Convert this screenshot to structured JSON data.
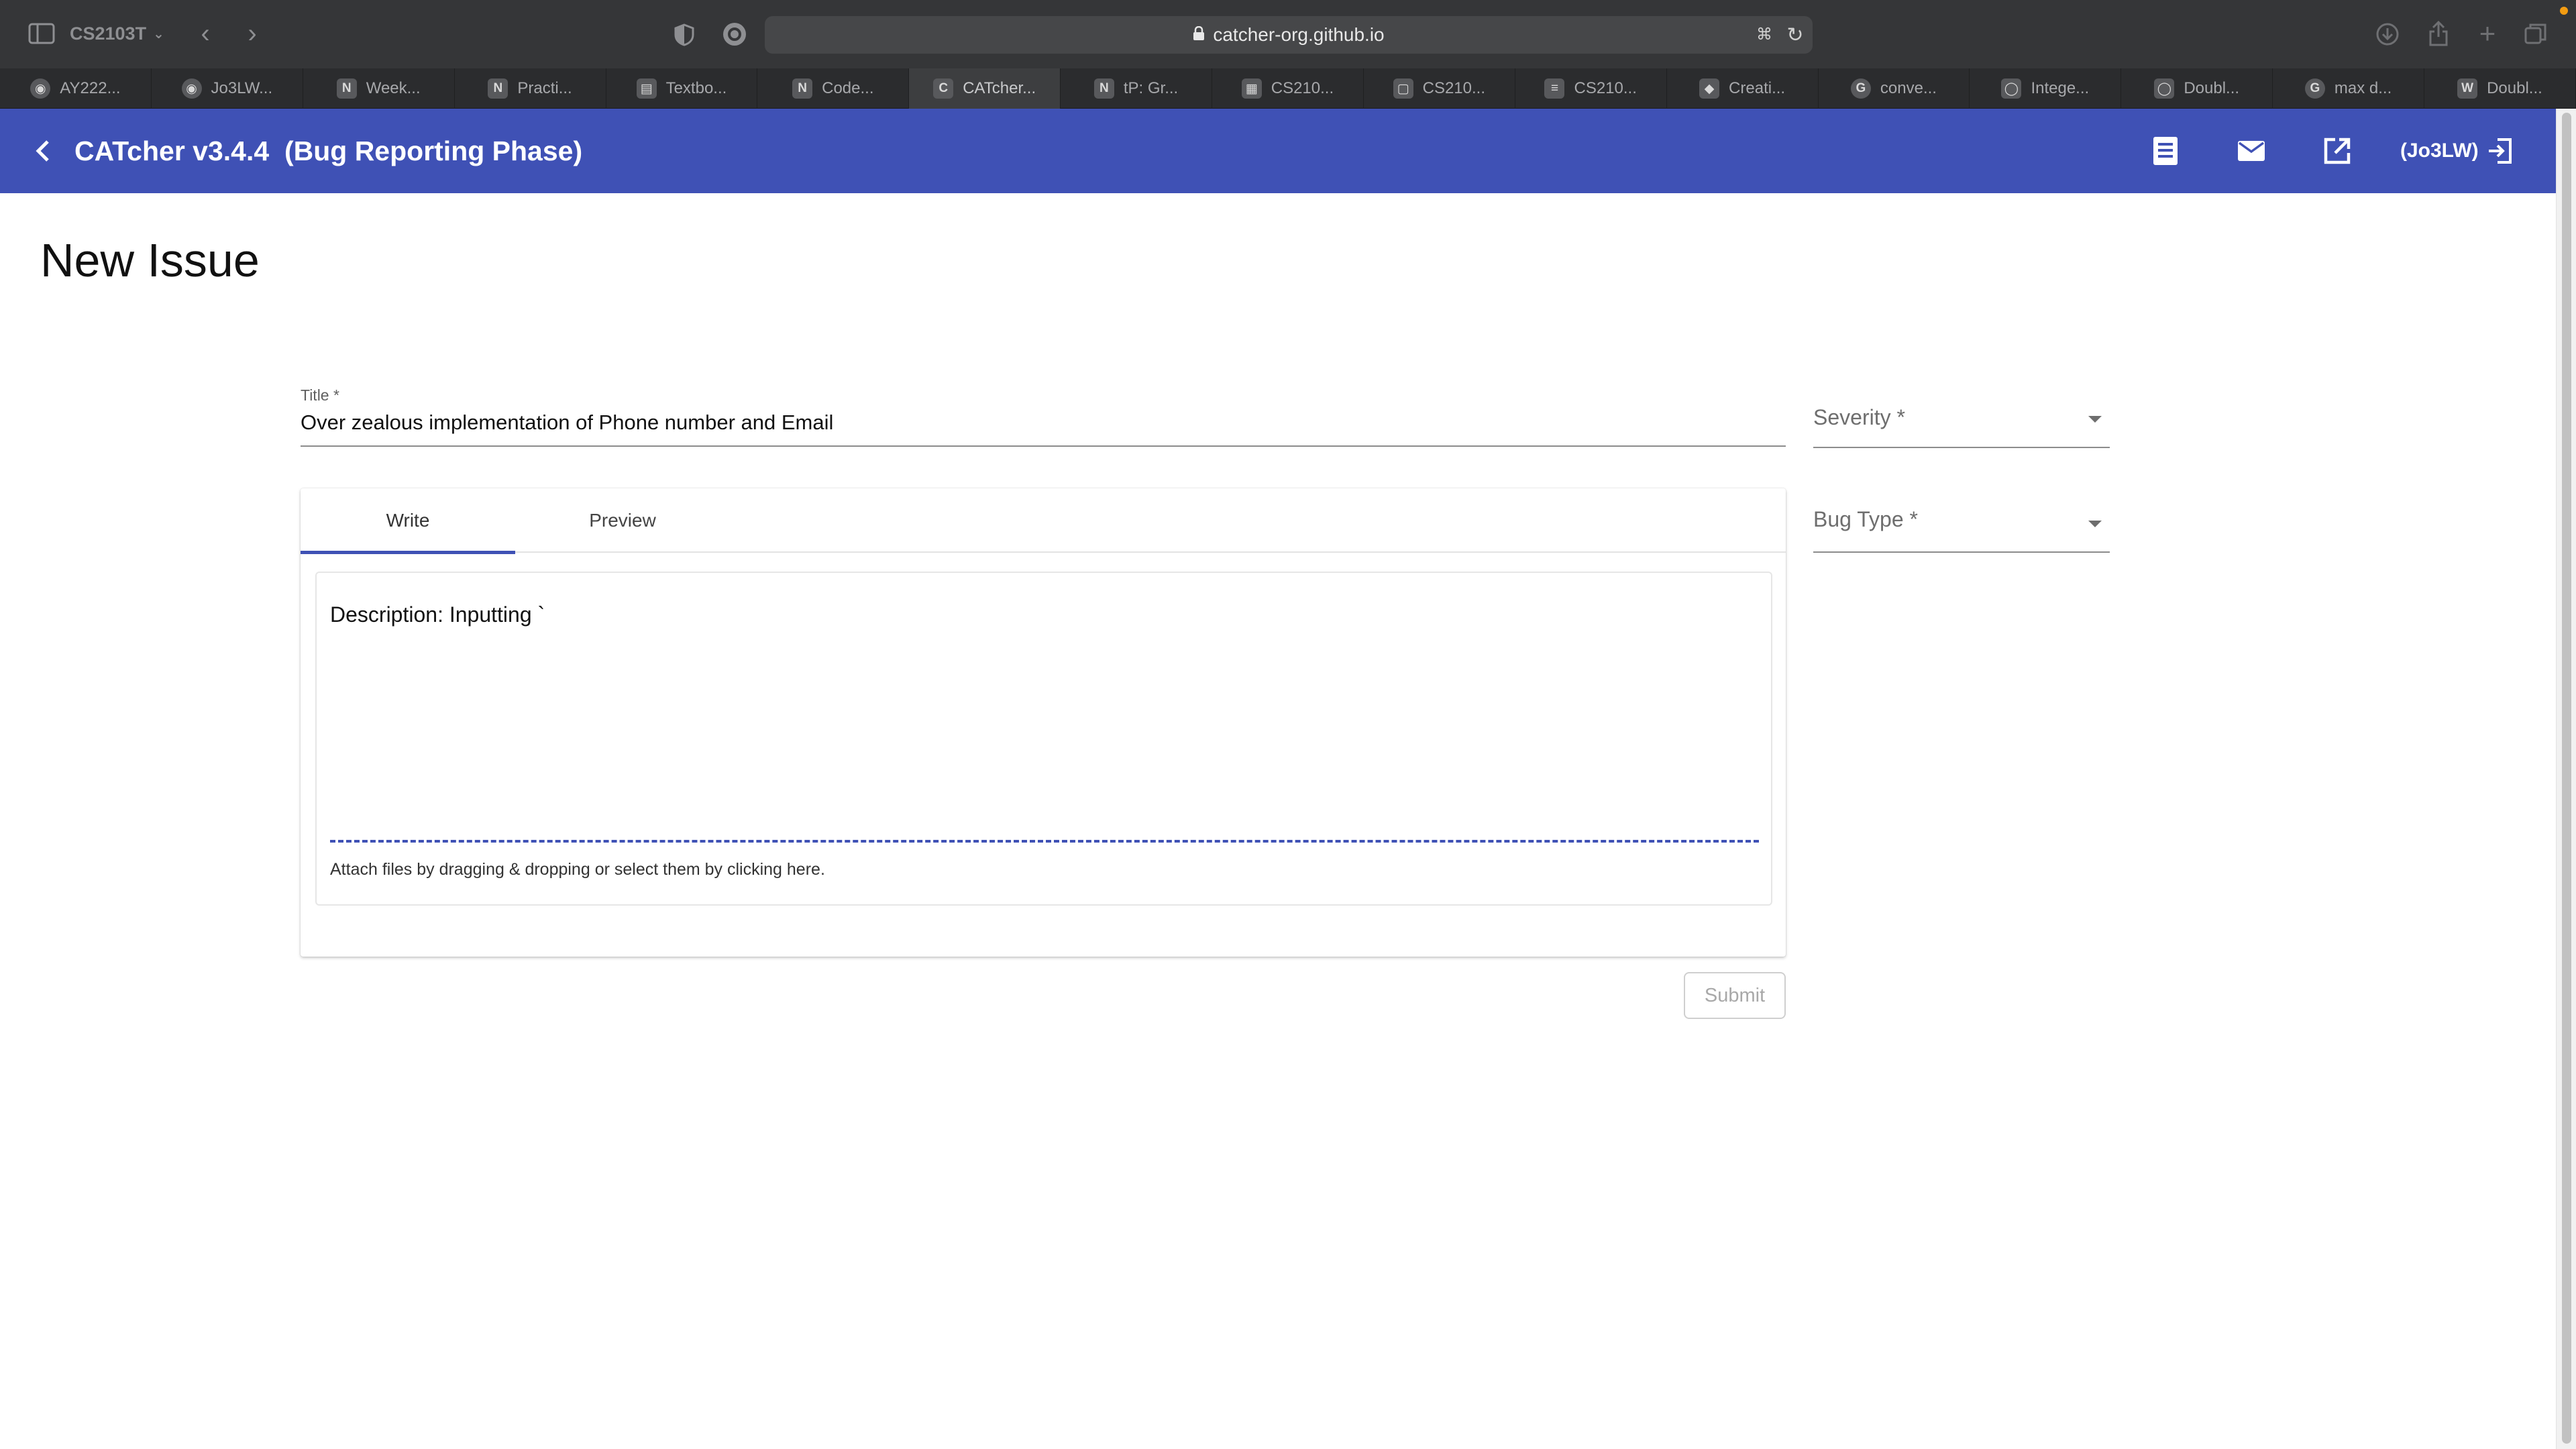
{
  "browser": {
    "tab_group": "CS2103T",
    "url": "catcher-org.github.io",
    "tabs": [
      {
        "label": "AY222...",
        "icon": "github-icon",
        "glyph": "◉"
      },
      {
        "label": "Jo3LW...",
        "icon": "github-icon",
        "glyph": "◉"
      },
      {
        "label": "Week...",
        "icon": "notion-icon",
        "glyph": "N"
      },
      {
        "label": "Practi...",
        "icon": "notion-icon",
        "glyph": "N"
      },
      {
        "label": "Textbo...",
        "icon": "book-icon",
        "glyph": "▤"
      },
      {
        "label": "Code...",
        "icon": "notion-icon",
        "glyph": "N"
      },
      {
        "label": "CATcher...",
        "icon": "catcher-icon",
        "glyph": "C"
      },
      {
        "label": "tP: Gr...",
        "icon": "notion-icon",
        "glyph": "N"
      },
      {
        "label": "CS210...",
        "icon": "grid-icon",
        "glyph": "▦"
      },
      {
        "label": "CS210...",
        "icon": "doc-icon",
        "glyph": "▢"
      },
      {
        "label": "CS210...",
        "icon": "doc-icon",
        "glyph": "≡"
      },
      {
        "label": "Creati...",
        "icon": "leaf-icon",
        "glyph": "◆"
      },
      {
        "label": "conve...",
        "icon": "google-icon",
        "glyph": "G"
      },
      {
        "label": "Intege...",
        "icon": "leetcode-icon",
        "glyph": "◯"
      },
      {
        "label": "Doubl...",
        "icon": "leetcode-icon",
        "glyph": "◯"
      },
      {
        "label": "max d...",
        "icon": "google-icon",
        "glyph": "G"
      },
      {
        "label": "Doubl...",
        "icon": "wiki-icon",
        "glyph": "W"
      }
    ]
  },
  "app": {
    "title": "CATcher v3.4.4  (Bug Reporting Phase)",
    "user": "(Jo3LW)",
    "bar_color": "#3f51b5"
  },
  "page": {
    "heading": "New Issue",
    "title_label": "Title *",
    "title_value": "Over zealous implementation of Phone number and Email",
    "severity_label": "Severity *",
    "bug_type_label": "Bug Type *",
    "tabs": [
      {
        "label": "Write"
      },
      {
        "label": "Preview"
      }
    ],
    "description_text": "Description: Inputting `",
    "attach_text": "Attach files by dragging & dropping or select them by clicking here.",
    "submit_label": "Submit"
  }
}
